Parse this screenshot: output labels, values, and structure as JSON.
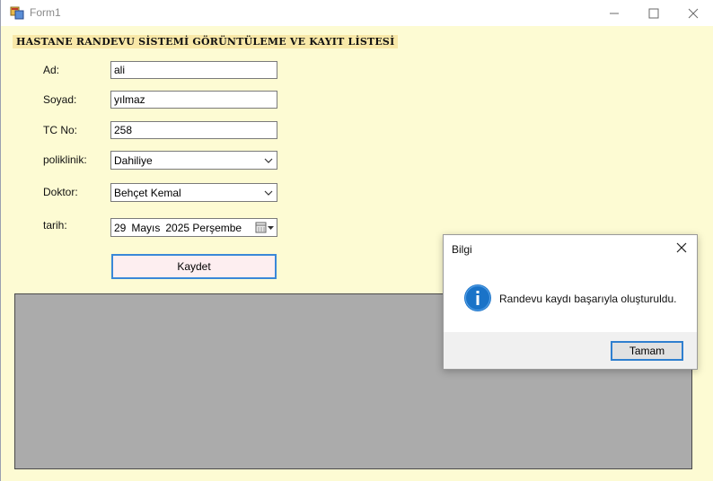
{
  "window": {
    "title": "Form1"
  },
  "form": {
    "heading": "HASTANE RANDEVU SİSTEMİ GÖRÜNTÜLEME VE KAYIT LİSTESİ",
    "fields": {
      "ad_label": "Ad:",
      "ad_value": "ali",
      "soyad_label": "Soyad:",
      "soyad_value": "yılmaz",
      "tc_label": "TC No:",
      "tc_value": "258",
      "poliklinik_label": "poliklinik:",
      "poliklinik_value": "Dahiliye",
      "doktor_label": "Doktor:",
      "doktor_value": "Behçet Kemal",
      "tarih_label": "tarih:",
      "tarih_day": "29",
      "tarih_month": "Mayıs",
      "tarih_year_weekday": "2025 Perşembe"
    },
    "save_button": "Kaydet"
  },
  "dialog": {
    "title": "Bilgi",
    "message": "Randevu kaydı başarıyla oluşturuldu.",
    "ok_button": "Tamam"
  },
  "colors": {
    "form_background": "#fdfbd3",
    "heading_background": "#f8e8a8",
    "grid_background": "#ababab",
    "accent_border": "#3a88d8",
    "info_icon": "#1a73c8"
  },
  "icons": {
    "app": "form-app-icon",
    "minimize": "minimize-icon",
    "maximize": "maximize-icon",
    "close": "close-icon",
    "dropdown": "chevron-down-icon",
    "calendar": "calendar-icon",
    "info": "info-icon"
  }
}
